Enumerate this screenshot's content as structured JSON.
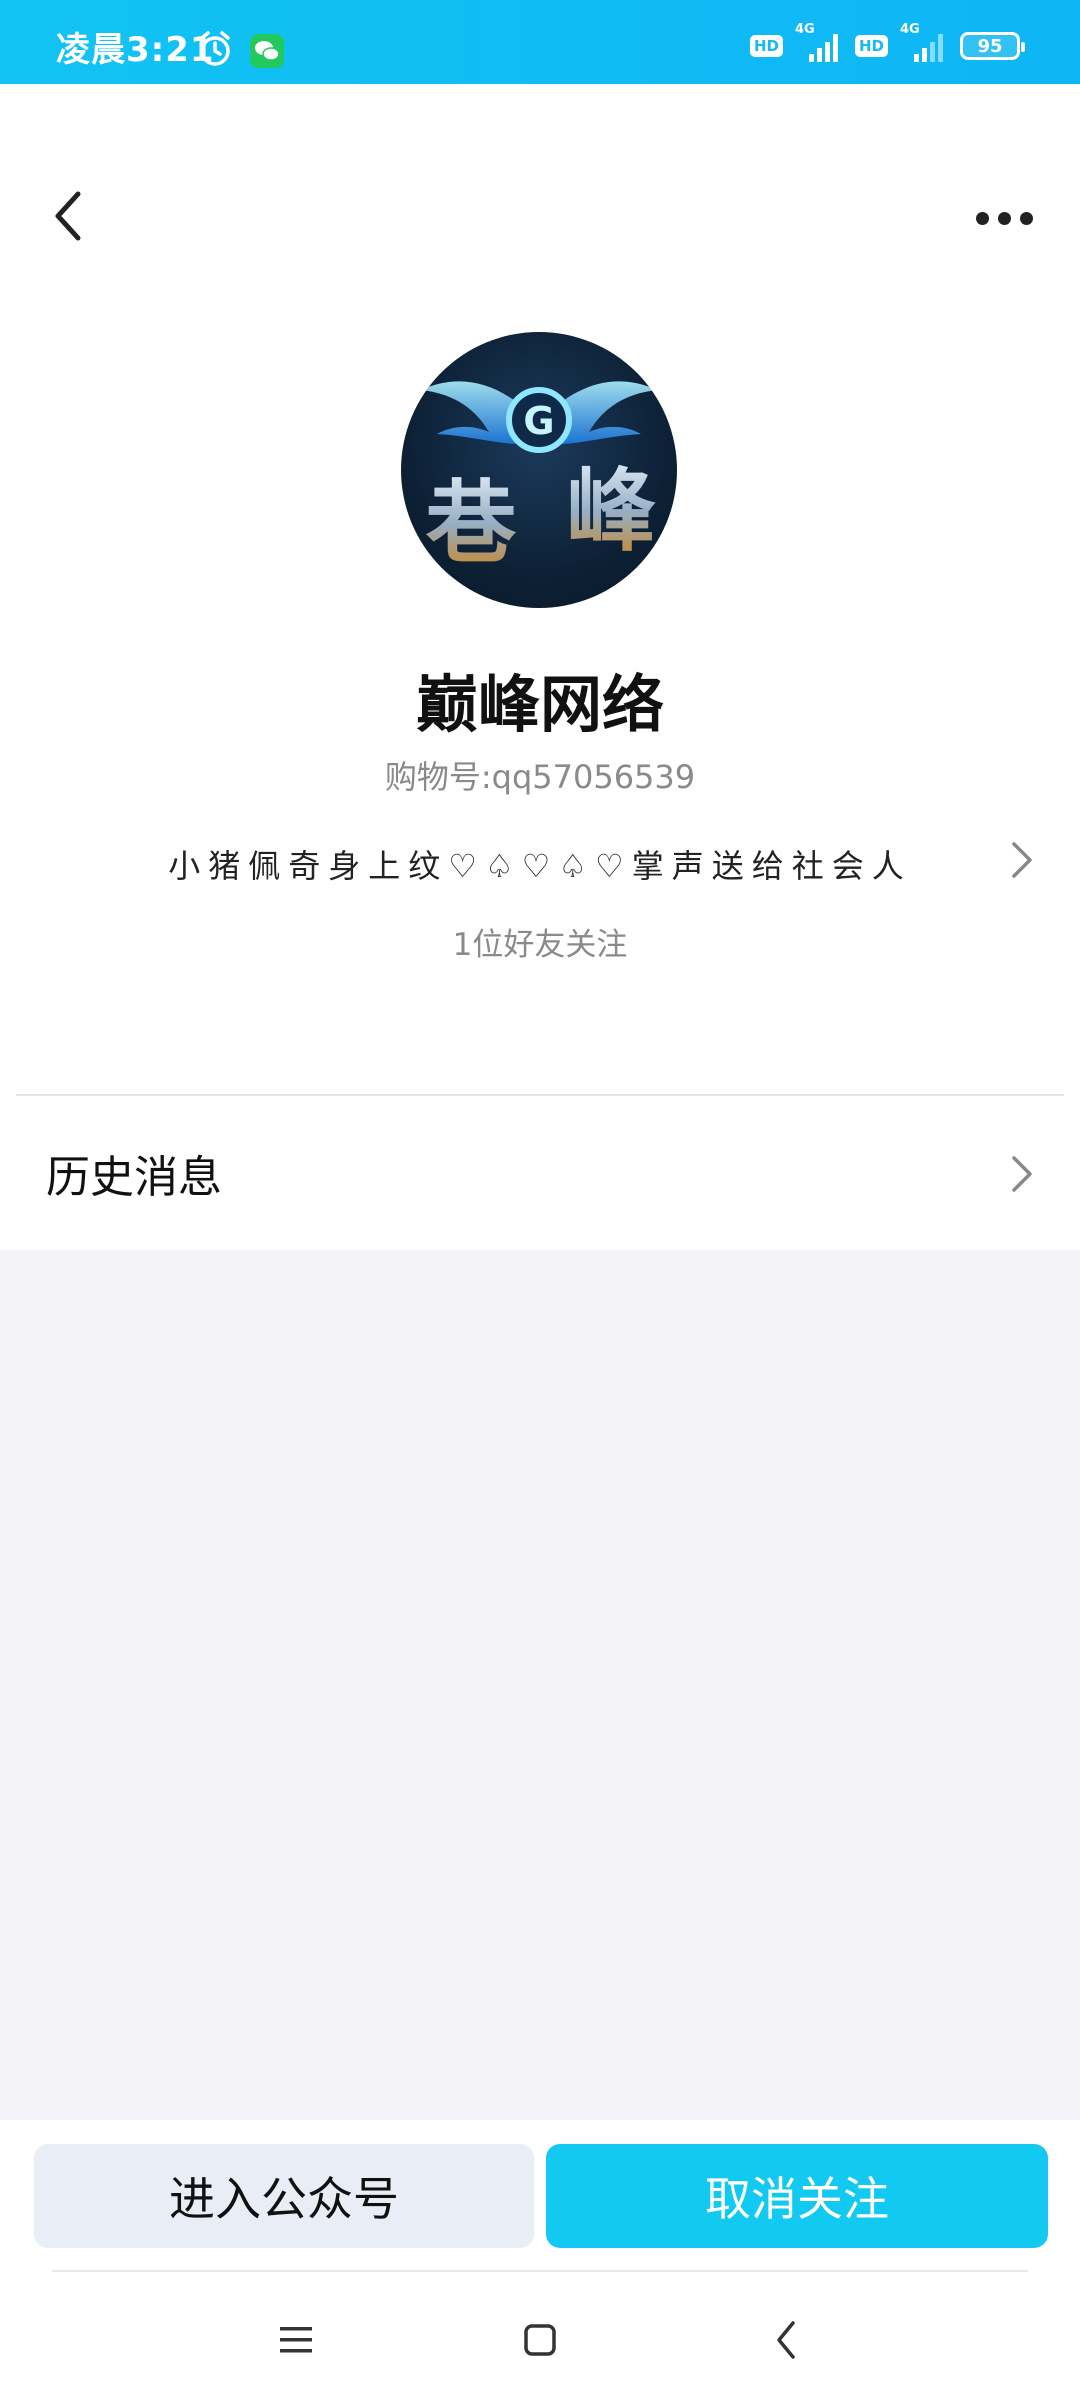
{
  "status_bar": {
    "time": "凌晨3:21",
    "icons": [
      "alarm-icon",
      "wechat-icon",
      "hd-icon",
      "signal-icon",
      "hd-icon",
      "signal-icon",
      "battery-icon"
    ],
    "network_label_1": "4G",
    "network_label_2": "4G",
    "hd_label": "HD",
    "battery": "95",
    "accent_color": "#12c3f3"
  },
  "header": {
    "back_icon": "chevron-left-icon",
    "more_icon": "more-dots-icon"
  },
  "profile": {
    "name": "巅峰网络",
    "shop_id": "购物号:qq57056539",
    "description": "小猪佩奇身上纹♡♤♡♤♡掌声送给社会人",
    "followers": "1位好友关注"
  },
  "menu": {
    "history_label": "历史消息"
  },
  "actions": {
    "enter_label": "进入公众号",
    "unfollow_label": "取消关注",
    "unfollow_color": "#12c9f1"
  },
  "navigation": {
    "items": [
      "menu-icon",
      "home-icon",
      "back-icon"
    ]
  }
}
